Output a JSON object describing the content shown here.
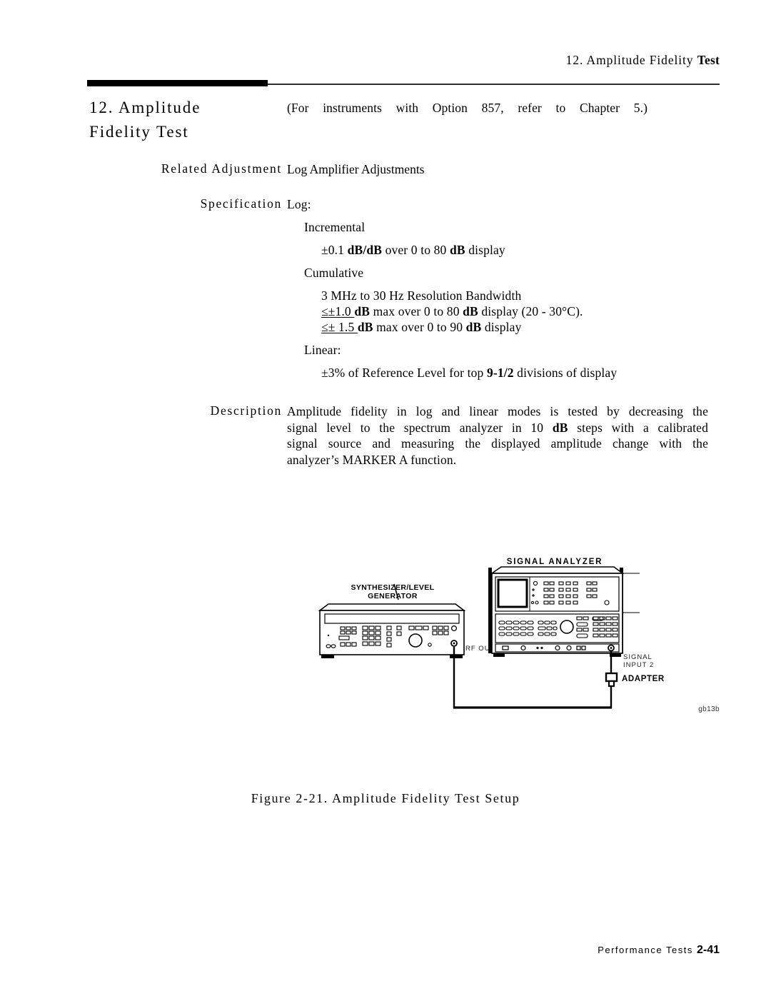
{
  "header": {
    "running_head_normal": "12. Amplitude Fidelity ",
    "running_head_bold": "Test"
  },
  "title": {
    "line1": "12. Amplitude",
    "line2": "Fidelity Test"
  },
  "note": "(For instruments with Option 857, refer to Chapter 5.)",
  "sections": {
    "related_adjustment": {
      "label": "Related Adjustment",
      "value": "Log Amplifier Adjustments"
    },
    "specification": {
      "label": "Specification",
      "log_heading": "Log:",
      "incremental_heading": "Incremental",
      "incremental_value_pre": "±0.1 ",
      "incremental_value_bold1": "dB/dB",
      "incremental_value_mid": " over 0 to 80 ",
      "incremental_value_bold2": "dB",
      "incremental_value_post": " display",
      "cumulative_heading": "Cumulative",
      "cumulative_line1": "3 MHz to 30 Hz Resolution Bandwidth",
      "cumulative_line2_pre": "≤±1.0 ",
      "cumulative_line2_bold1": "dB",
      "cumulative_line2_mid": " max over 0 to 80 ",
      "cumulative_line2_bold2": "dB",
      "cumulative_line2_post": " display (20 - 30°C).",
      "cumulative_line3_pre": "≤± 1.5 ",
      "cumulative_line3_bold1": "dB",
      "cumulative_line3_mid": " max over 0 to 90 ",
      "cumulative_line3_bold2": "dB",
      "cumulative_line3_post": " display",
      "linear_heading": "Linear:",
      "linear_value_pre": "±3% of Reference Level for top ",
      "linear_value_bold": "9-1/2",
      "linear_value_post": " divisions of display"
    },
    "description": {
      "label": "Description",
      "line1_pre": "Amplitude fidelity in log and linear modes is tested by decreasing the",
      "line2_pre": "signal level to the spectrum analyzer in 10 ",
      "line2_bold": "dB",
      "line2_post": " steps with a calibrated",
      "line3": "signal source and measuring the displayed amplitude change with the",
      "line4": "analyzer’s MARKER A function."
    }
  },
  "figure": {
    "caption": "Figure 2-21. Amplitude Fidelity Test Setup",
    "id": "gb13b",
    "labels": {
      "signal_analyzer": "SIGNAL ANALYZER",
      "synthesizer_line1": "SYNTHESIZER/LEVEL",
      "synthesizer_line2": "GENERATOR",
      "rf_output": "RF OUTPUT",
      "signal_input_line1": "SIGNAL",
      "signal_input_line2": "INPUT 2",
      "adapter": "ADAPTER"
    }
  },
  "footer": {
    "text": "Performance Tests",
    "page": "2-41"
  }
}
